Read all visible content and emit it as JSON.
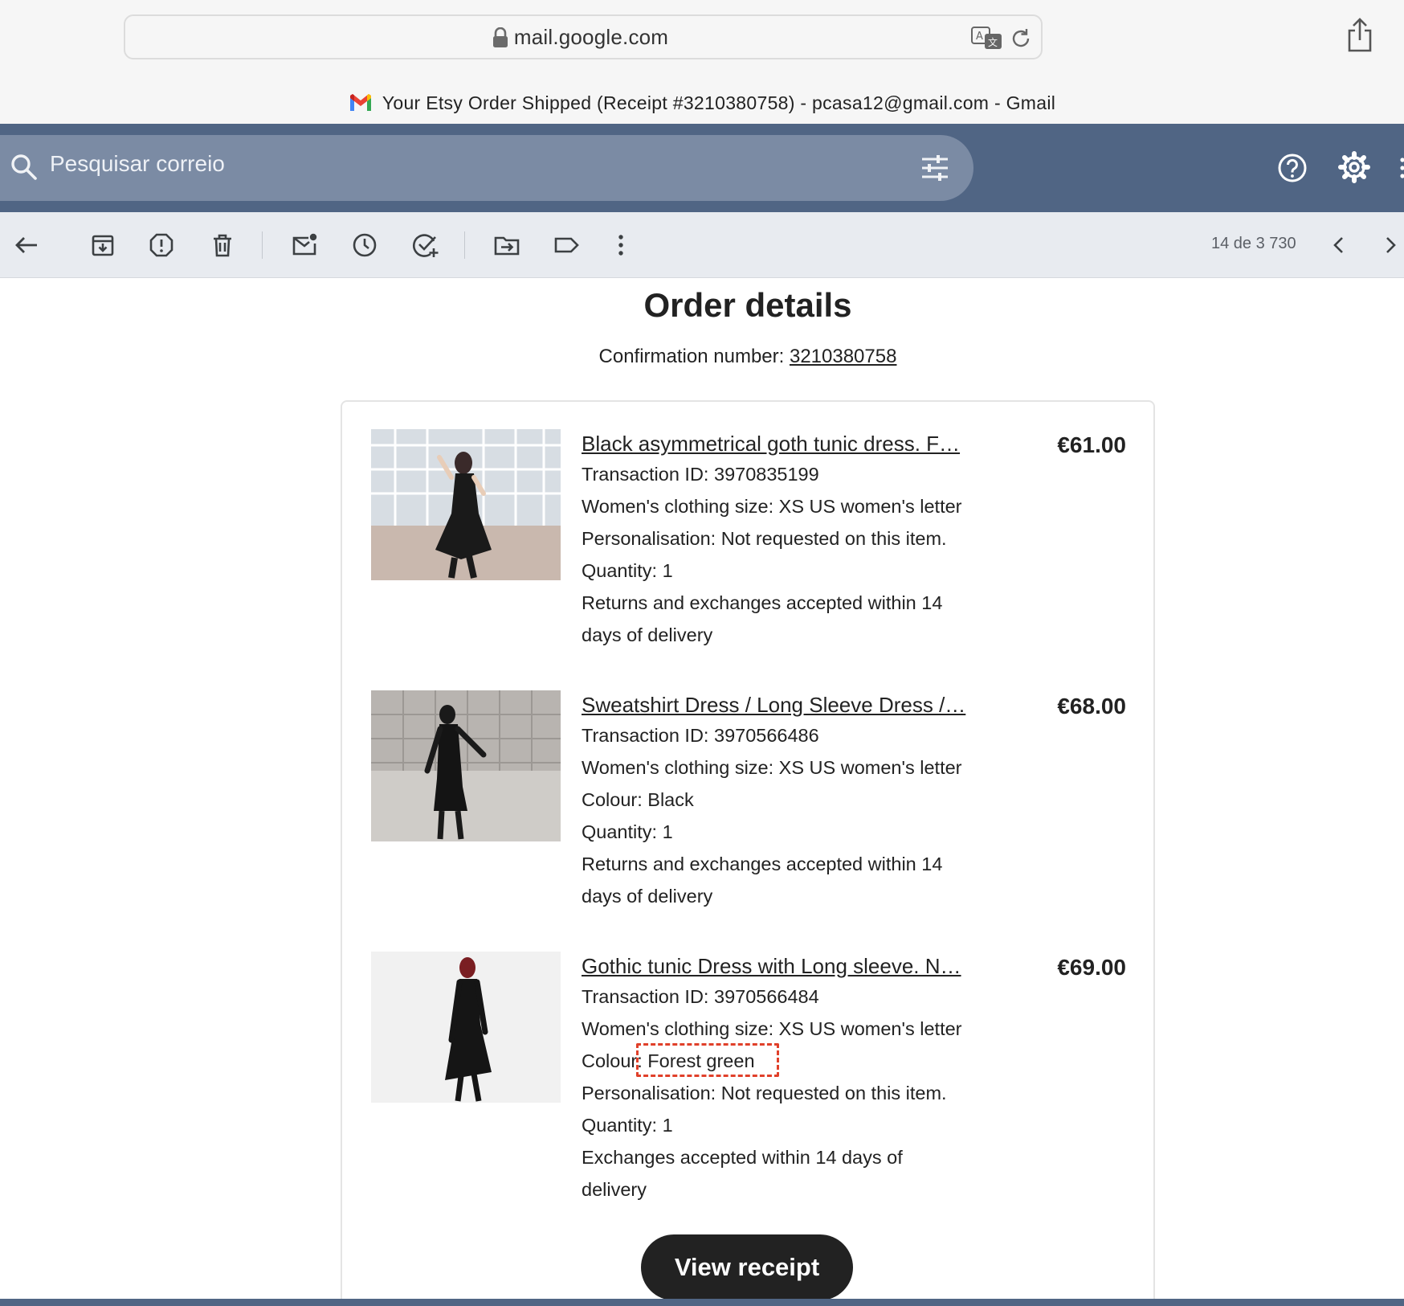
{
  "browser": {
    "url": "mail.google.com",
    "tab_title": "Your Etsy Order Shipped (Receipt #3210380758) - pcasa12@gmail.com - Gmail"
  },
  "gmail": {
    "search_placeholder": "Pesquisar correio",
    "pager": "14 de 3 730",
    "header_color": "#506584",
    "toolbar_color": "#e8ebf0"
  },
  "toolbar_icons": [
    "back-arrow-icon",
    "archive-icon",
    "report-spam-icon",
    "delete-icon",
    "mark-unread-icon",
    "snooze-icon",
    "add-task-icon",
    "move-to-icon",
    "label-icon",
    "more-vert-icon"
  ],
  "email": {
    "heading": "Order details",
    "confirmation_label": "Confirmation number: ",
    "confirmation_number": "3210380758",
    "items": [
      {
        "title": "Black asymmetrical goth tunic dress. F…",
        "price": "€61.00",
        "lines": [
          "Transaction ID: 3970835199",
          "Women's clothing size: XS US women's letter",
          "Personalisation: Not requested on this item.",
          "Quantity: 1",
          "Returns and exchanges accepted within 14",
          "days of delivery"
        ]
      },
      {
        "title": "Sweatshirt Dress / Long Sleeve Dress /…",
        "price": "€68.00",
        "lines": [
          "Transaction ID: 3970566486",
          "Women's clothing size: XS US women's letter",
          "Colour: Black",
          "Quantity: 1",
          "Returns and exchanges accepted within 14",
          "days of delivery"
        ]
      },
      {
        "title": "Gothic tunic Dress with Long sleeve. N…",
        "price": "€69.00",
        "lines": [
          "Transaction ID: 3970566484",
          "Women's clothing size: XS US women's letter",
          "Colour: Forest green",
          "Personalisation: Not requested on this item.",
          "Quantity: 1",
          "Exchanges accepted within 14 days of",
          "delivery"
        ]
      }
    ],
    "view_receipt_label": "View receipt",
    "highlight_color": "#e0402a"
  }
}
